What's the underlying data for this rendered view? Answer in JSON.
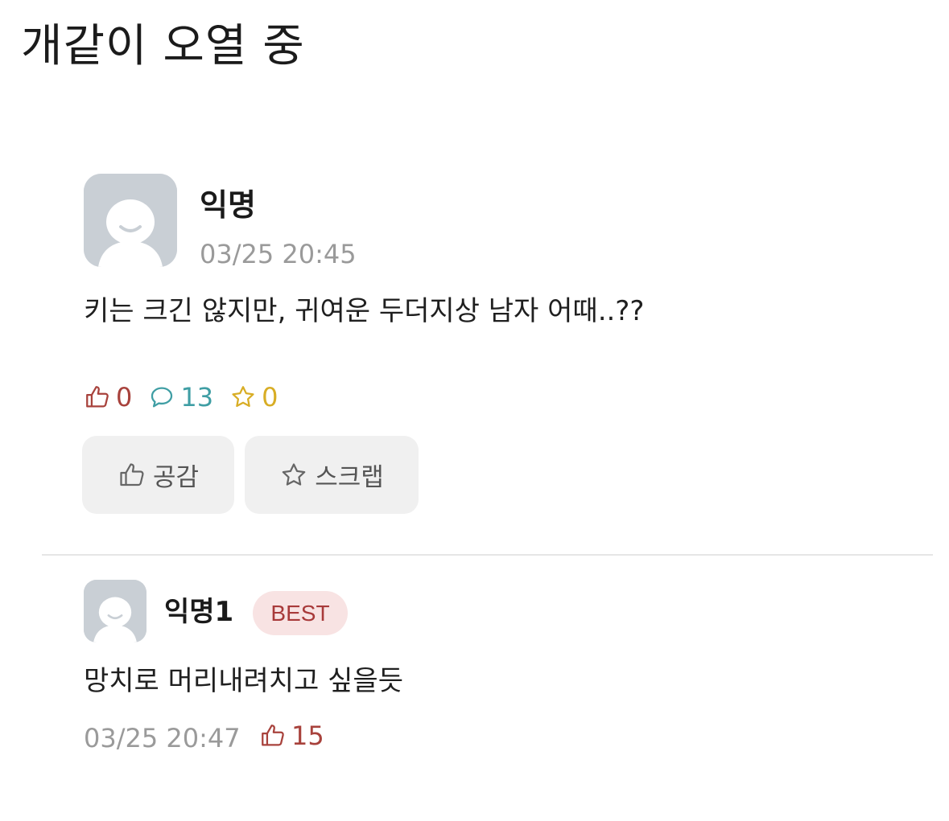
{
  "caption": "개같이 오열 중",
  "post": {
    "author": "익명",
    "time": "03/25 20:45",
    "body": "키는 크긴 않지만, 귀여운 두더지상 남자 어때..??",
    "stats": {
      "likes": "0",
      "comments": "13",
      "scraps": "0"
    },
    "actions": {
      "like_label": "공감",
      "scrap_label": "스크랩"
    }
  },
  "comment": {
    "author": "익명1",
    "badge": "BEST",
    "body": "망치로 머리내려치고 싶을듯",
    "time": "03/25 20:47",
    "likes": "15"
  },
  "colors": {
    "like": "#a8423c",
    "comment": "#3f9ea4",
    "scrap": "#d8ad25",
    "badge_bg": "#f8e3e3",
    "avatar_bg": "#c9cfd5"
  },
  "icons": [
    "thumbs-up-icon",
    "speech-bubble-icon",
    "star-icon",
    "default-avatar-icon"
  ]
}
